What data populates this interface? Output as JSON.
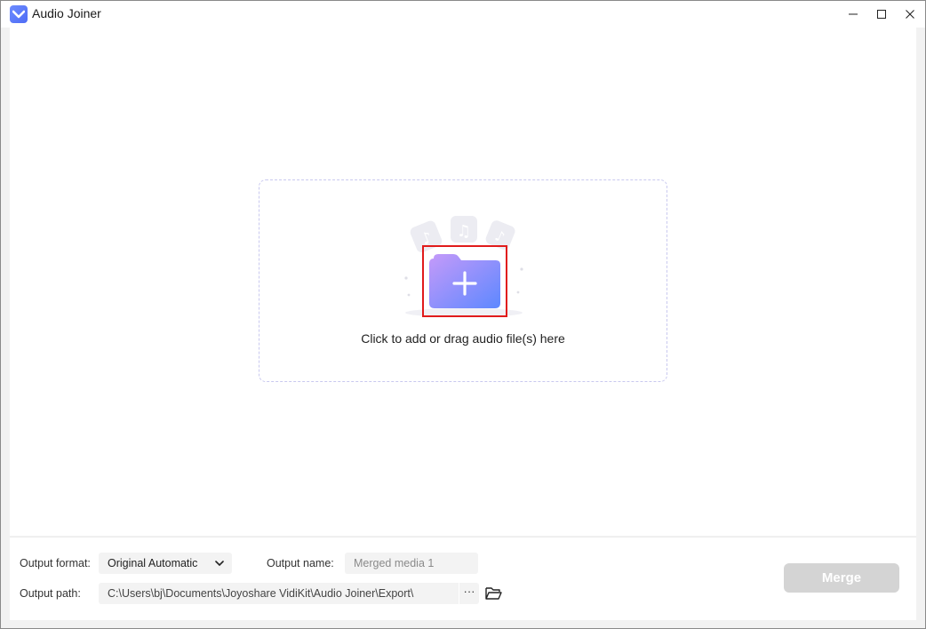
{
  "window": {
    "title": "Audio Joiner",
    "controls": {
      "minimize_icon": "minimize-icon",
      "maximize_icon": "maximize-icon",
      "close_icon": "close-icon"
    }
  },
  "dropzone": {
    "text": "Click to add or drag audio file(s) here",
    "add_icon": "plus-folder-icon"
  },
  "output": {
    "format_label": "Output format:",
    "format_value": "Original Automatic",
    "name_label": "Output name:",
    "name_placeholder": "Merged media 1",
    "path_label": "Output path:",
    "path_value": "C:\\Users\\bj\\Documents\\Joyoshare VidiKit\\Audio Joiner\\Export\\",
    "path_more": "···",
    "merge_label": "Merge"
  },
  "colors": {
    "accent": "#6f86ff",
    "folder_gradient_start": "#c59af9",
    "folder_gradient_end": "#5d88ff",
    "highlight_border": "#e11b1b",
    "merge_disabled": "#d4d4d4"
  }
}
